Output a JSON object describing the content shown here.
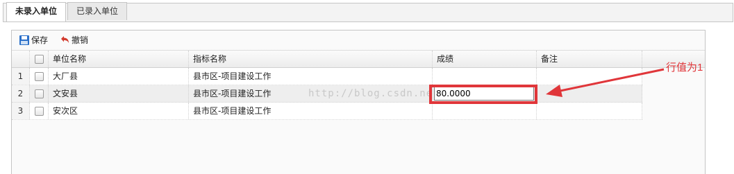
{
  "tabs": [
    {
      "label": "未录入单位",
      "active": true
    },
    {
      "label": "已录入单位",
      "active": false
    }
  ],
  "toolbar": {
    "save_label": "保存",
    "cancel_label": "撤销"
  },
  "grid": {
    "columns": [
      "单位名称",
      "指标名称",
      "成绩",
      "备注"
    ],
    "rows": [
      {
        "num": "1",
        "unit": "大厂县",
        "indicator": "县市区-项目建设工作",
        "score": "",
        "note": ""
      },
      {
        "num": "2",
        "unit": "文安县",
        "indicator": "县市区-项目建设工作",
        "score": "80.0000",
        "note": ""
      },
      {
        "num": "3",
        "unit": "安次区",
        "indicator": "县市区-项目建设工作",
        "score": "",
        "note": ""
      }
    ]
  },
  "watermark": "http://blog.csdn.ne",
  "annotation": "行值为1",
  "colors": {
    "accent_red": "#e0363a",
    "save_icon_blue": "#2a6fc9"
  }
}
